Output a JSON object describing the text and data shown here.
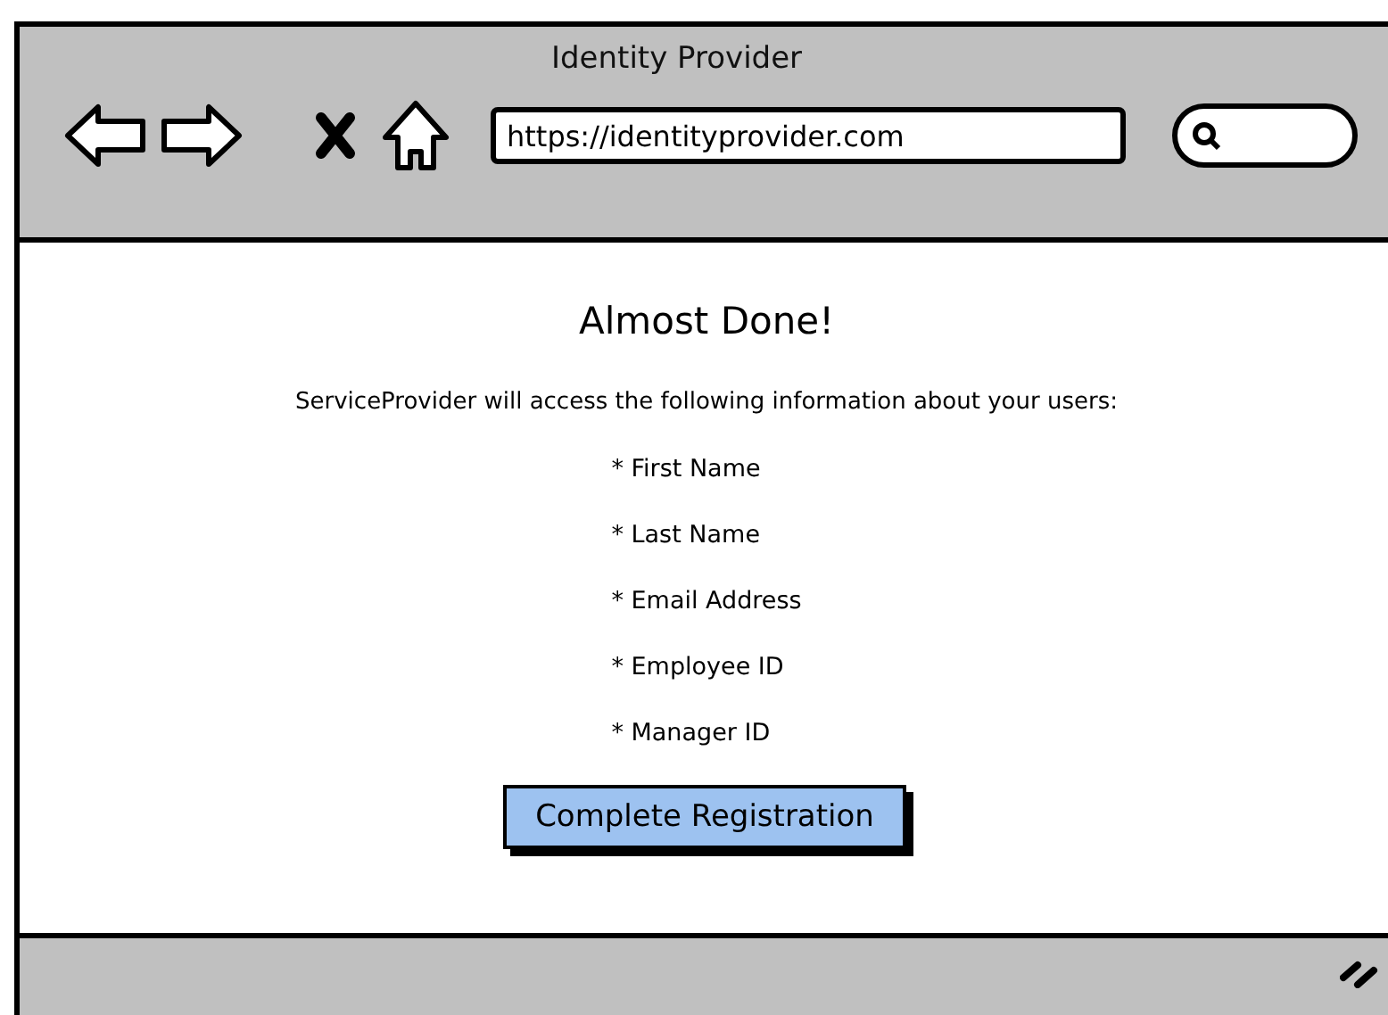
{
  "window": {
    "title": "Identity Provider"
  },
  "address_bar": {
    "value": "https://identityprovider.com"
  },
  "content": {
    "heading": "Almost Done!",
    "intro": "ServiceProvider will access the following information about your users:",
    "items": [
      "* First Name",
      "* Last Name",
      "* Email Address",
      "* Employee ID",
      "* Manager ID"
    ],
    "button": "Complete Registration"
  }
}
